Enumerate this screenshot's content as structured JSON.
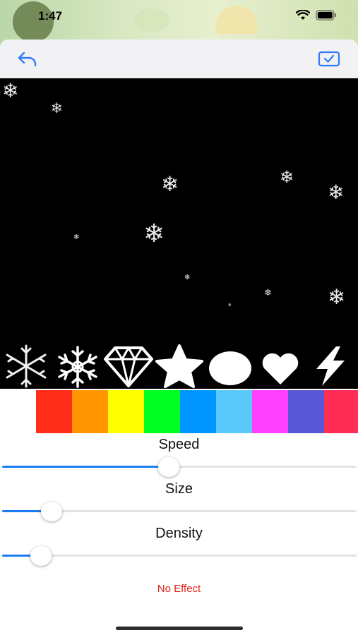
{
  "status_bar": {
    "time": "1:47"
  },
  "nav": {
    "back_icon": "undo-arrow-icon",
    "confirm_icon": "checkmark-box-icon",
    "accent_color": "#2f7bf6"
  },
  "canvas": {
    "background": "#000000",
    "particle": "snowflake"
  },
  "shapes": [
    {
      "name": "snowflake-thin"
    },
    {
      "name": "snowflake-ornate"
    },
    {
      "name": "diamond"
    },
    {
      "name": "star"
    },
    {
      "name": "circle"
    },
    {
      "name": "heart"
    },
    {
      "name": "lightning"
    }
  ],
  "colors": [
    "#ffffff",
    "#ff2d1a",
    "#ff9500",
    "#ffff00",
    "#00ff22",
    "#0096ff",
    "#5ac8fa",
    "#ff40ff",
    "#5856d6",
    "#ff2d55"
  ],
  "controls": {
    "speed": {
      "label": "Speed",
      "value": 0.47
    },
    "size": {
      "label": "Size",
      "value": 0.14
    },
    "density": {
      "label": "Density",
      "value": 0.11
    }
  },
  "no_effect_label": "No Effect"
}
